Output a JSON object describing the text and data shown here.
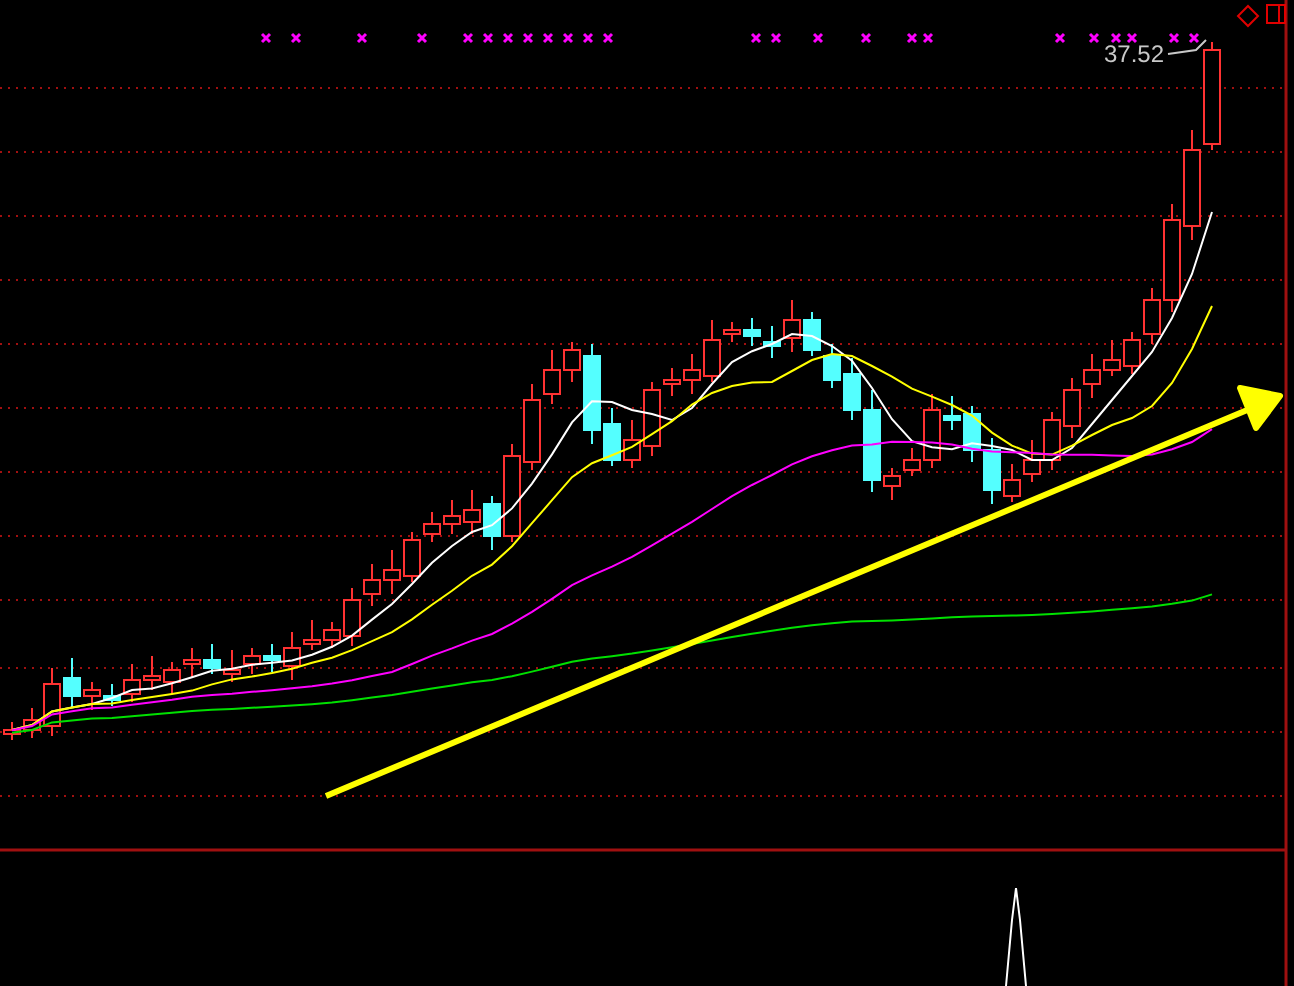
{
  "chart": {
    "price_label": "37.52"
  }
}
